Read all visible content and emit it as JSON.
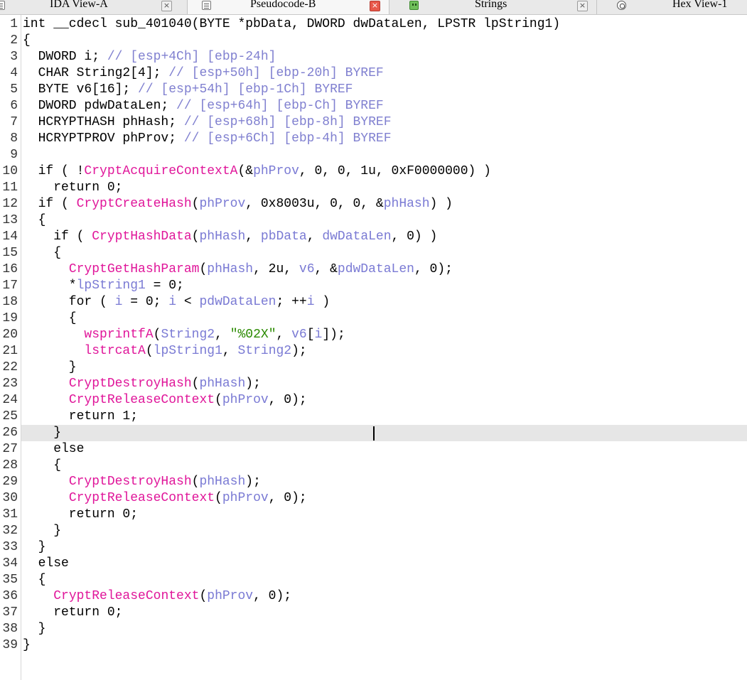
{
  "tabs": [
    {
      "label": "IDA View-A",
      "active": false,
      "icon": "disassembly-icon"
    },
    {
      "label": "Pseudocode-B",
      "active": true,
      "icon": "pseudocode-icon"
    },
    {
      "label": "Strings",
      "active": false,
      "icon": "strings-icon"
    },
    {
      "label": "Hex View-1",
      "active": false,
      "icon": "hex-view-icon"
    }
  ],
  "colors": {
    "function": "#e0169a",
    "variable": "#7a7ad4",
    "comment": "#8080d0",
    "string": "#2a8a00",
    "highlight": "#e6e6e6"
  },
  "editor": {
    "cursor_line": 26,
    "lines": [
      [
        [
          "t",
          "int __cdecl sub_401040(BYTE *pbData, DWORD dwDataLen, LPSTR lpString1)"
        ]
      ],
      [
        [
          "t",
          "{"
        ]
      ],
      [
        [
          "t",
          "  DWORD i; "
        ],
        [
          "c",
          "// [esp+4Ch] [ebp-24h]"
        ]
      ],
      [
        [
          "t",
          "  CHAR String2[4]; "
        ],
        [
          "c",
          "// [esp+50h] [ebp-20h] BYREF"
        ]
      ],
      [
        [
          "t",
          "  BYTE v6[16]; "
        ],
        [
          "c",
          "// [esp+54h] [ebp-1Ch] BYREF"
        ]
      ],
      [
        [
          "t",
          "  DWORD pdwDataLen; "
        ],
        [
          "c",
          "// [esp+64h] [ebp-Ch] BYREF"
        ]
      ],
      [
        [
          "t",
          "  HCRYPTHASH phHash; "
        ],
        [
          "c",
          "// [esp+68h] [ebp-8h] BYREF"
        ]
      ],
      [
        [
          "t",
          "  HCRYPTPROV phProv; "
        ],
        [
          "c",
          "// [esp+6Ch] [ebp-4h] BYREF"
        ]
      ],
      [
        [
          "t",
          ""
        ]
      ],
      [
        [
          "t",
          "  if ( !"
        ],
        [
          "f",
          "CryptAcquireContextA"
        ],
        [
          "t",
          "(&"
        ],
        [
          "v",
          "phProv"
        ],
        [
          "t",
          ", 0, 0, 1u, 0xF0000000) )"
        ]
      ],
      [
        [
          "t",
          "    return 0;"
        ]
      ],
      [
        [
          "t",
          "  if ( "
        ],
        [
          "f",
          "CryptCreateHash"
        ],
        [
          "t",
          "("
        ],
        [
          "v",
          "phProv"
        ],
        [
          "t",
          ", 0x8003u, 0, 0, &"
        ],
        [
          "v",
          "phHash"
        ],
        [
          "t",
          ") )"
        ]
      ],
      [
        [
          "t",
          "  {"
        ]
      ],
      [
        [
          "t",
          "    if ( "
        ],
        [
          "f",
          "CryptHashData"
        ],
        [
          "t",
          "("
        ],
        [
          "v",
          "phHash"
        ],
        [
          "t",
          ", "
        ],
        [
          "v",
          "pbData"
        ],
        [
          "t",
          ", "
        ],
        [
          "v",
          "dwDataLen"
        ],
        [
          "t",
          ", 0) )"
        ]
      ],
      [
        [
          "t",
          "    {"
        ]
      ],
      [
        [
          "t",
          "      "
        ],
        [
          "f",
          "CryptGetHashParam"
        ],
        [
          "t",
          "("
        ],
        [
          "v",
          "phHash"
        ],
        [
          "t",
          ", 2u, "
        ],
        [
          "v",
          "v6"
        ],
        [
          "t",
          ", &"
        ],
        [
          "v",
          "pdwDataLen"
        ],
        [
          "t",
          ", 0);"
        ]
      ],
      [
        [
          "t",
          "      *"
        ],
        [
          "v",
          "lpString1"
        ],
        [
          "t",
          " = 0;"
        ]
      ],
      [
        [
          "t",
          "      for ( "
        ],
        [
          "v",
          "i"
        ],
        [
          "t",
          " = 0; "
        ],
        [
          "v",
          "i"
        ],
        [
          "t",
          " < "
        ],
        [
          "v",
          "pdwDataLen"
        ],
        [
          "t",
          "; ++"
        ],
        [
          "v",
          "i"
        ],
        [
          "t",
          " )"
        ]
      ],
      [
        [
          "t",
          "      {"
        ]
      ],
      [
        [
          "t",
          "        "
        ],
        [
          "f",
          "wsprintfA"
        ],
        [
          "t",
          "("
        ],
        [
          "v",
          "String2"
        ],
        [
          "t",
          ", "
        ],
        [
          "s",
          "\"%02X\""
        ],
        [
          "t",
          ", "
        ],
        [
          "v",
          "v6"
        ],
        [
          "t",
          "["
        ],
        [
          "v",
          "i"
        ],
        [
          "t",
          "]);"
        ]
      ],
      [
        [
          "t",
          "        "
        ],
        [
          "f",
          "lstrcatA"
        ],
        [
          "t",
          "("
        ],
        [
          "v",
          "lpString1"
        ],
        [
          "t",
          ", "
        ],
        [
          "v",
          "String2"
        ],
        [
          "t",
          ");"
        ]
      ],
      [
        [
          "t",
          "      }"
        ]
      ],
      [
        [
          "t",
          "      "
        ],
        [
          "f",
          "CryptDestroyHash"
        ],
        [
          "t",
          "("
        ],
        [
          "v",
          "phHash"
        ],
        [
          "t",
          ");"
        ]
      ],
      [
        [
          "t",
          "      "
        ],
        [
          "f",
          "CryptReleaseContext"
        ],
        [
          "t",
          "("
        ],
        [
          "v",
          "phProv"
        ],
        [
          "t",
          ", 0);"
        ]
      ],
      [
        [
          "t",
          "      return 1;"
        ]
      ],
      [
        [
          "t",
          "    }"
        ]
      ],
      [
        [
          "t",
          "    else"
        ]
      ],
      [
        [
          "t",
          "    {"
        ]
      ],
      [
        [
          "t",
          "      "
        ],
        [
          "f",
          "CryptDestroyHash"
        ],
        [
          "t",
          "("
        ],
        [
          "v",
          "phHash"
        ],
        [
          "t",
          ");"
        ]
      ],
      [
        [
          "t",
          "      "
        ],
        [
          "f",
          "CryptReleaseContext"
        ],
        [
          "t",
          "("
        ],
        [
          "v",
          "phProv"
        ],
        [
          "t",
          ", 0);"
        ]
      ],
      [
        [
          "t",
          "      return 0;"
        ]
      ],
      [
        [
          "t",
          "    }"
        ]
      ],
      [
        [
          "t",
          "  }"
        ]
      ],
      [
        [
          "t",
          "  else"
        ]
      ],
      [
        [
          "t",
          "  {"
        ]
      ],
      [
        [
          "t",
          "    "
        ],
        [
          "f",
          "CryptReleaseContext"
        ],
        [
          "t",
          "("
        ],
        [
          "v",
          "phProv"
        ],
        [
          "t",
          ", 0);"
        ]
      ],
      [
        [
          "t",
          "    return 0;"
        ]
      ],
      [
        [
          "t",
          "  }"
        ]
      ],
      [
        [
          "t",
          "}"
        ]
      ]
    ]
  }
}
